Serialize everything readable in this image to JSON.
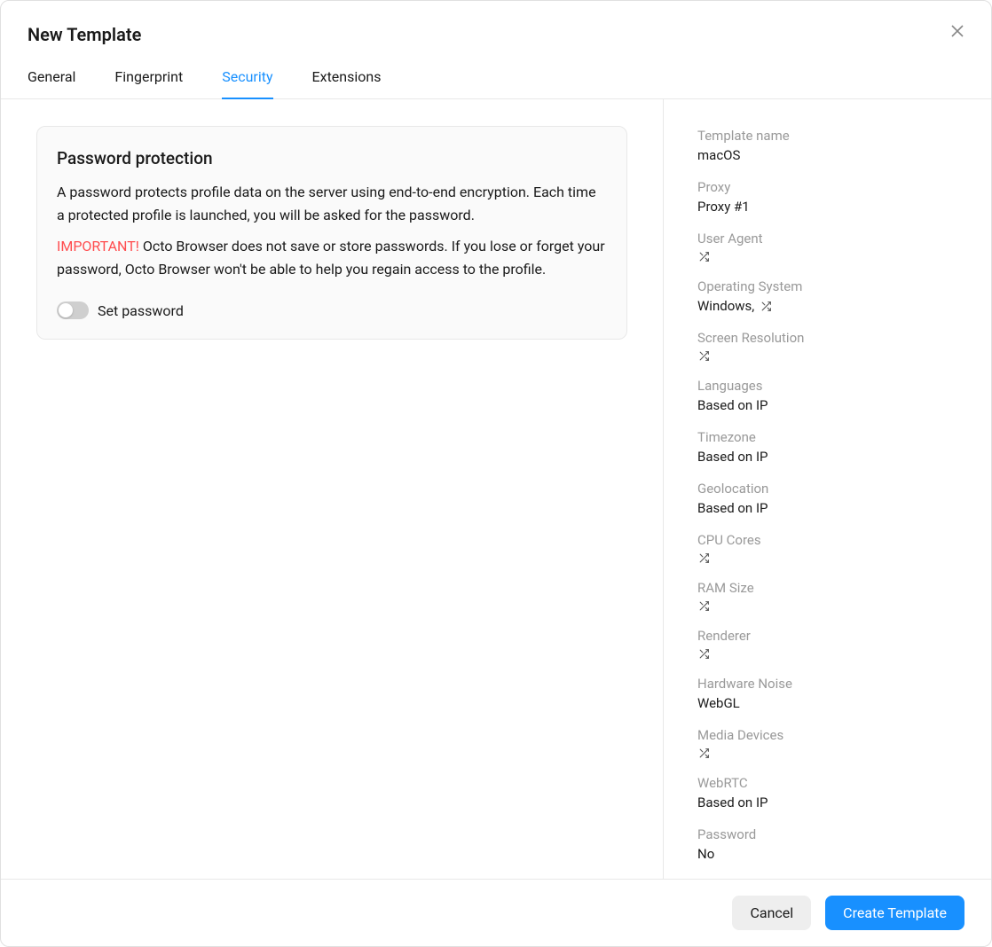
{
  "modal": {
    "title": "New Template"
  },
  "tabs": [
    {
      "label": "General",
      "active": false
    },
    {
      "label": "Fingerprint",
      "active": false
    },
    {
      "label": "Security",
      "active": true
    },
    {
      "label": "Extensions",
      "active": false
    }
  ],
  "security": {
    "card_title": "Password protection",
    "description": "A password protects profile data on the server using end-to-end encryption. Each time a protected profile is launched, you will be asked for the password.",
    "important_prefix": "IMPORTANT!",
    "important_text": " Octo Browser does not save or store passwords. If you lose or forget your password, Octo Browser won't be able to help you regain access to the profile.",
    "toggle_label": "Set password",
    "toggle_on": false
  },
  "summary": [
    {
      "label": "Template name",
      "value": "macOS",
      "shuffle": false
    },
    {
      "label": "Proxy",
      "value": "Proxy #1",
      "shuffle": false
    },
    {
      "label": "User Agent",
      "value": "",
      "shuffle": true
    },
    {
      "label": "Operating System",
      "value": "Windows, ",
      "shuffle": true,
      "inline_shuffle": true
    },
    {
      "label": "Screen Resolution",
      "value": "",
      "shuffle": true
    },
    {
      "label": "Languages",
      "value": "Based on IP",
      "shuffle": false
    },
    {
      "label": "Timezone",
      "value": "Based on IP",
      "shuffle": false
    },
    {
      "label": "Geolocation",
      "value": "Based on IP",
      "shuffle": false
    },
    {
      "label": "CPU Cores",
      "value": "",
      "shuffle": true
    },
    {
      "label": "RAM Size",
      "value": "",
      "shuffle": true
    },
    {
      "label": "Renderer",
      "value": "",
      "shuffle": true
    },
    {
      "label": "Hardware Noise",
      "value": "WebGL",
      "shuffle": false
    },
    {
      "label": "Media Devices",
      "value": "",
      "shuffle": true
    },
    {
      "label": "WebRTC",
      "value": "Based on IP",
      "shuffle": false
    },
    {
      "label": "Password",
      "value": "No",
      "shuffle": false
    }
  ],
  "footer": {
    "cancel": "Cancel",
    "create": "Create Template"
  }
}
